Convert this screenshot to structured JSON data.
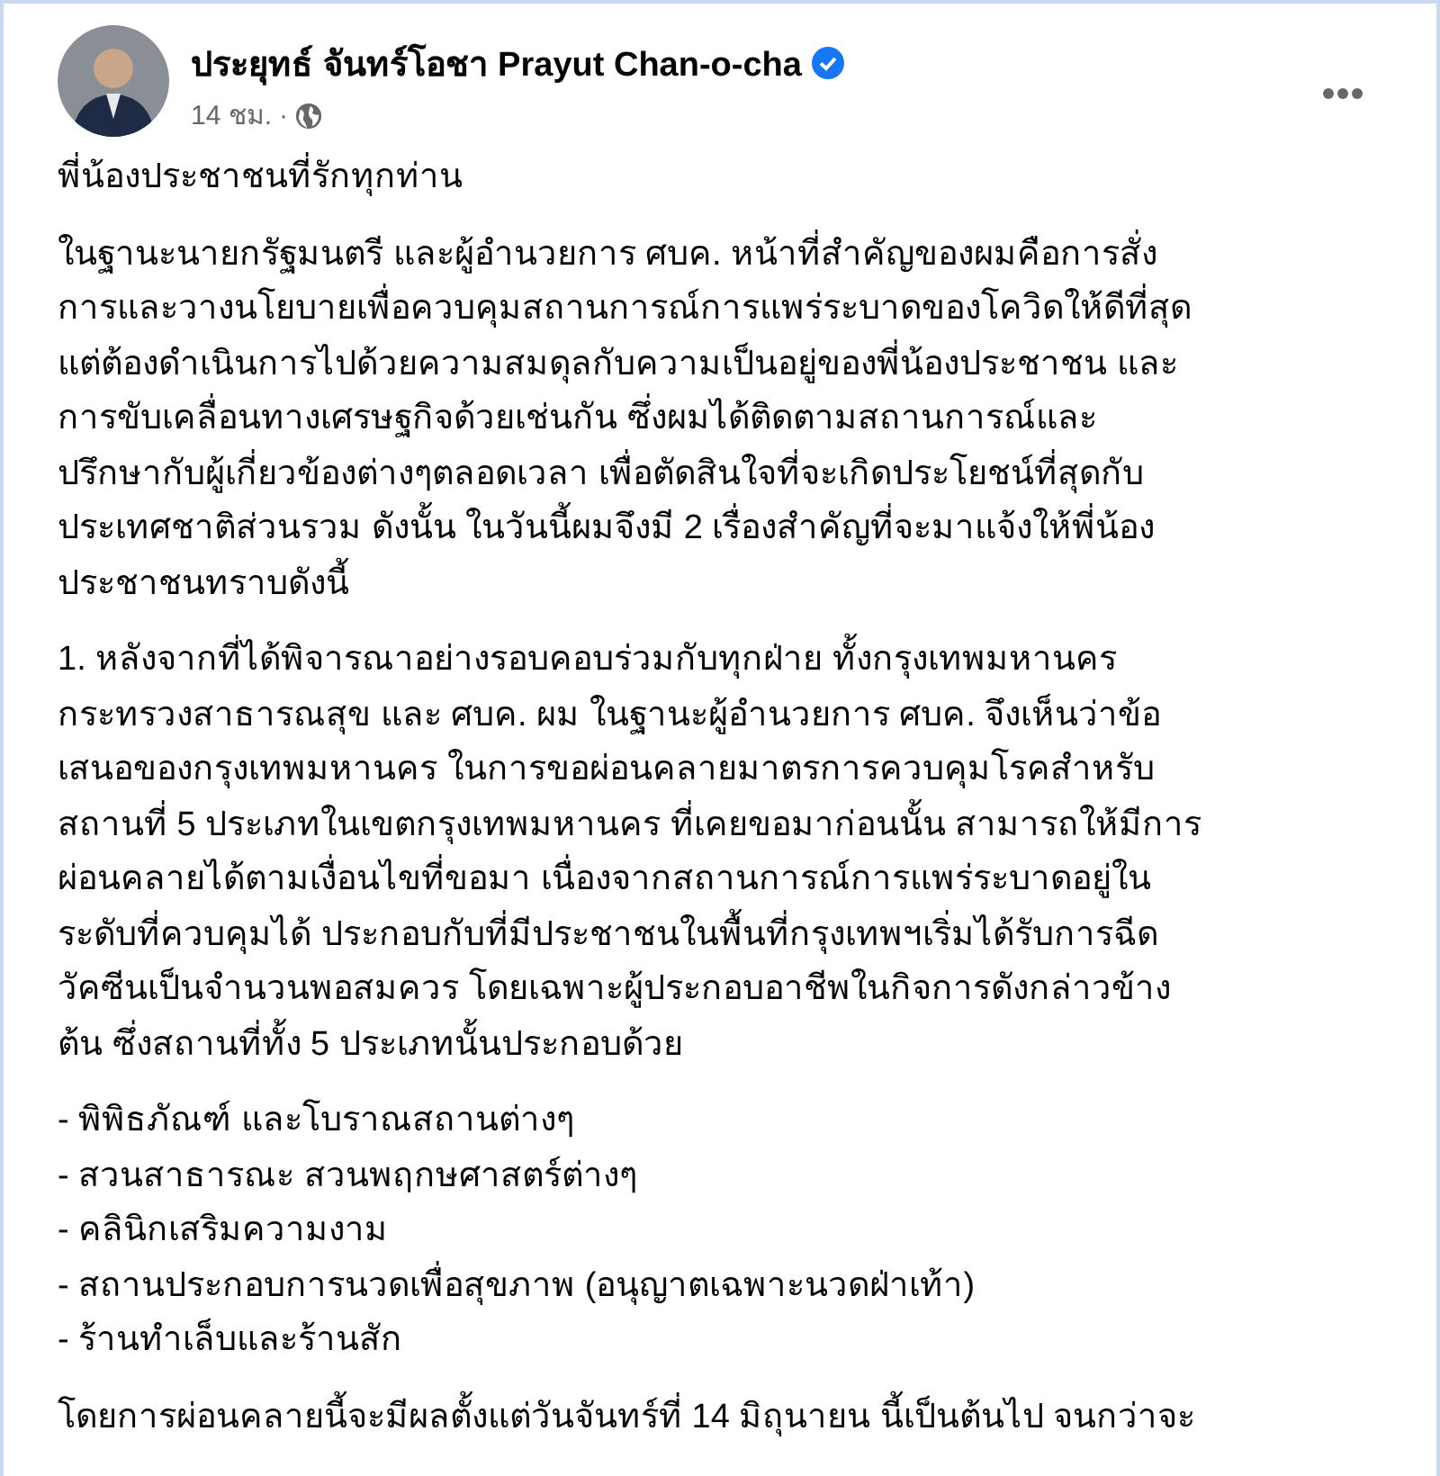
{
  "post": {
    "author": "ประยุทธ์ จันทร์โอชา Prayut Chan-o-cha",
    "verified": true,
    "time": "14 ชม.",
    "separator": "·",
    "paragraphs": [
      {
        "kind": "text",
        "text": "พี่น้องประชาชนที่รักทุกท่าน"
      },
      {
        "kind": "text",
        "text": "ในฐานะนายกรัฐมนตรี และผู้อำนวยการ ศบค. หน้าที่สำคัญของผมคือการสั่ง\nการและวางนโยบายเพื่อควบคุมสถานการณ์การแพร่ระบาดของโควิดให้ดีที่สุด\nแต่ต้องดำเนินการไปด้วยความสมดุลกับความเป็นอยู่ของพี่น้องประชาชน และ\nการขับเคลื่อนทางเศรษฐกิจด้วยเช่นกัน ซึ่งผมได้ติดตามสถานการณ์และ\nปรึกษากับผู้เกี่ยวข้องต่างๆตลอดเวลา เพื่อตัดสินใจที่จะเกิดประโยชน์ที่สุดกับ\nประเทศชาติส่วนรวม ดังนั้น ในวันนี้ผมจึงมี 2 เรื่องสำคัญที่จะมาแจ้งให้พี่น้อง\nประชาชนทราบดังนี้"
      },
      {
        "kind": "text",
        "text": "1. หลังจากที่ได้พิจารณาอย่างรอบคอบร่วมกับทุกฝ่าย ทั้งกรุงเทพมหานคร\nกระทรวงสาธารณสุข และ ศบค. ผม ในฐานะผู้อำนวยการ ศบค. จึงเห็นว่าข้อ\nเสนอของกรุงเทพมหานคร ในการขอผ่อนคลายมาตรการควบคุมโรคสำหรับ\nสถานที่ 5 ประเภทในเขตกรุงเทพมหานคร ที่เคยขอมาก่อนนั้น สามารถให้มีการ\nผ่อนคลายได้ตามเงื่อนไขที่ขอมา เนื่องจากสถานการณ์การแพร่ระบาดอยู่ใน\nระดับที่ควบคุมได้ ประกอบกับที่มีประชาชนในพื้นที่กรุงเทพฯเริ่มได้รับการฉีด\nวัคซีนเป็นจำนวนพอสมควร โดยเฉพาะผู้ประกอบอาชีพในกิจการดังกล่าวข้าง\nต้น ซึ่งสถานที่ทั้ง 5 ประเภทนั้นประกอบด้วย"
      },
      {
        "kind": "list",
        "items": [
          "- พิพิธภัณฑ์ และโบราณสถานต่างๆ",
          "- สวนสาธารณะ สวนพฤกษศาสตร์ต่างๆ",
          "- คลินิกเสริมความงาม",
          "- สถานประกอบการนวดเพื่อสุขภาพ (อนุญาตเฉพาะนวดฝ่าเท้า)",
          "- ร้านทำเล็บและร้านสัก"
        ]
      },
      {
        "kind": "text",
        "text": "โดยการผ่อนคลายนี้จะมีผลตั้งแต่วันจันทร์ที่ 14 มิถุนายน นี้เป็นต้นไป จนกว่าจะ"
      }
    ]
  }
}
